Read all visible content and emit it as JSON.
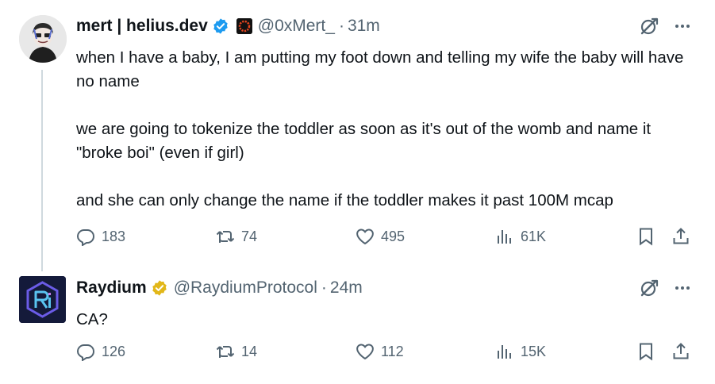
{
  "tweets": [
    {
      "author": {
        "name": "mert | helius.dev",
        "handle": "@0xMert_",
        "time": "31m",
        "verified_badge": "blue-check-icon",
        "org_badge": "helius-org-badge-icon"
      },
      "paragraphs": [
        "when I have a baby, I am putting my foot down and telling my wife the baby will have no name",
        "we are going to tokenize the toddler as soon as it's out of the womb and name it \"broke boi\" (even if girl)",
        "and she can only change the name if the toddler makes it past 100M mcap"
      ],
      "stats": {
        "replies": "183",
        "retweets": "74",
        "likes": "495",
        "views": "61K"
      }
    },
    {
      "author": {
        "name": "Raydium",
        "handle": "@RaydiumProtocol",
        "time": "24m",
        "verified_badge": "gold-check-icon"
      },
      "paragraphs": [
        "CA?"
      ],
      "stats": {
        "replies": "126",
        "retweets": "14",
        "likes": "112",
        "views": "15K"
      }
    }
  ],
  "separator": "·",
  "colors": {
    "text": "#0f1419",
    "secondary": "#536471",
    "blue_check": "#1d9bf0",
    "gold_check": "#e2b719",
    "thread_line": "#cfd9de"
  }
}
